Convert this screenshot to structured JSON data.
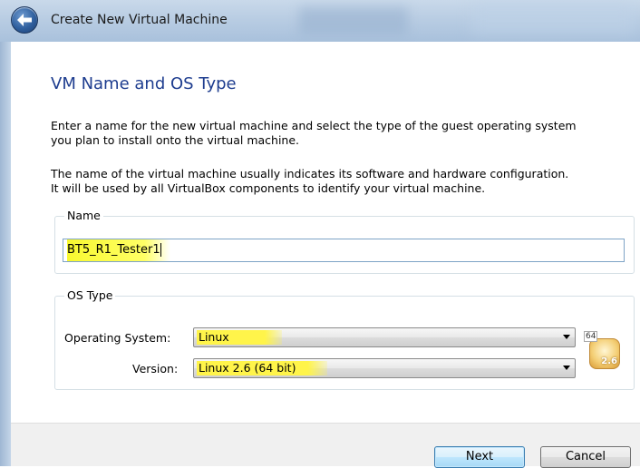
{
  "window": {
    "title": "Create New Virtual Machine"
  },
  "page": {
    "heading": "VM Name and OS Type",
    "intro_line1": "Enter a name for the new virtual machine and select the type of the guest operating system",
    "intro_line2": "you plan to install onto the virtual machine.",
    "info_line1": "The name of the virtual machine usually indicates its software and hardware configuration.",
    "info_line2": "It will be used by all VirtualBox components to identify your virtual machine."
  },
  "name_group": {
    "legend": "Name",
    "value": "BT5_R1_Tester1"
  },
  "os_group": {
    "legend": "OS Type",
    "os_label": "Operating System:",
    "os_value": "Linux",
    "version_label": "Version:",
    "version_value": "Linux 2.6 (64 bit)",
    "icon": {
      "name": "linux-2.6-64bit-icon",
      "bits_text": "64",
      "version_text": "2.6"
    }
  },
  "buttons": {
    "next": "Next",
    "cancel": "Cancel"
  },
  "colors": {
    "heading": "#1e3d8f",
    "highlight": "#ffff66"
  }
}
